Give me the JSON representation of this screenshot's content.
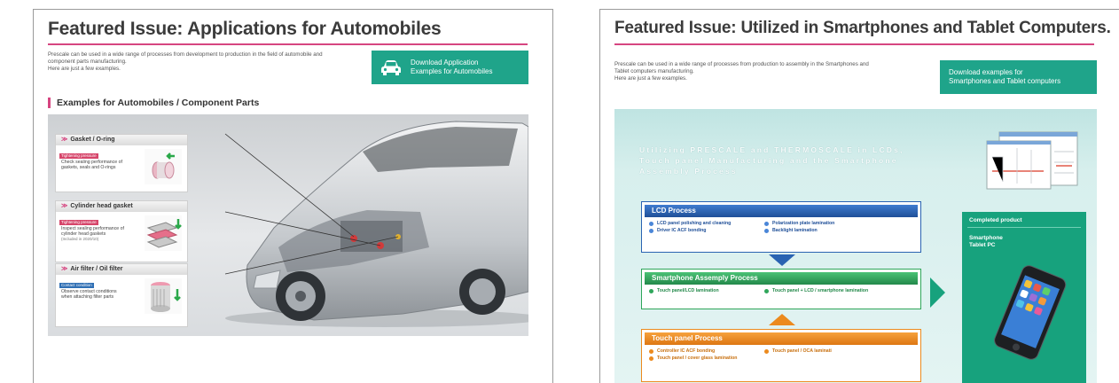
{
  "left": {
    "title": "Featured Issue: Applications for Automobiles",
    "intro": [
      "Prescale can be used in a wide range of processes from development to production in the field of automobile and",
      "component parts manufacturing.",
      "Here are just a few examples."
    ],
    "download": [
      "Download Application",
      "Examples for Automobiles"
    ],
    "section_title": "Examples for Automobiles / Component Parts",
    "callouts": [
      {
        "title": "Gasket / O-ring",
        "tag": "Tightening pressure",
        "tag_color": "#d6456a",
        "desc": [
          "Check sealing performance of",
          "gaskets, seals and O-rings"
        ],
        "note": ""
      },
      {
        "title": "Cylinder head gasket",
        "tag": "Tightening pressure",
        "tag_color": "#d6456a",
        "desc": [
          "Inspect sealing performance of",
          "cylinder head gaskets"
        ],
        "note": "(Included in 2020/10)"
      },
      {
        "title": "Air filter / Oil filter",
        "tag": "Contact condition",
        "tag_color": "#2f6fb4",
        "desc": [
          "Observe contact conditions",
          "when attaching filter parts"
        ],
        "note": ""
      }
    ]
  },
  "right": {
    "title": "Featured Issue:  Utilized in Smartphones and Tablet Computers.",
    "intro": [
      "Prescale can be used in a wide range of processes from production to assembly in the Smartphones and",
      "Tablet computers manufacturing.",
      "Here are just a few examples."
    ],
    "download": [
      "Download examples for",
      "Smartphones and Tablet computers"
    ],
    "banner_text": [
      "Utilizing PRESCALE and THERMOSCALE in LCDs,",
      "Touch panel Manufacturing and the Smartphone",
      "Assembly Process"
    ],
    "lcd": {
      "title": "LCD Process",
      "items": [
        "LCD panel polishing and cleaning",
        "Polarization plate lamination",
        "Driver IC ACF bonding",
        "Backlight lamination"
      ]
    },
    "smartphone": {
      "title": "Smartphone Assemply Process",
      "items": [
        "Touch panel/LCD lamination",
        "Touch panel + LCD / smartphone lamination"
      ]
    },
    "touch": {
      "title": "Touch panel Process",
      "items": [
        "Controller IC ACF bonding",
        "Touch panel / OCA laminati",
        "Touch panel / cover glass lamination"
      ]
    },
    "completed": {
      "title": "Completed product",
      "items": [
        "Smartphone",
        "Tablet PC"
      ]
    }
  },
  "colors": {
    "accent_pink": "#d64580",
    "button_green": "#1fa48a",
    "lcd_blue": "#2a63b2",
    "assembly_green": "#2fa65a",
    "touch_orange": "#ec8a1e"
  }
}
